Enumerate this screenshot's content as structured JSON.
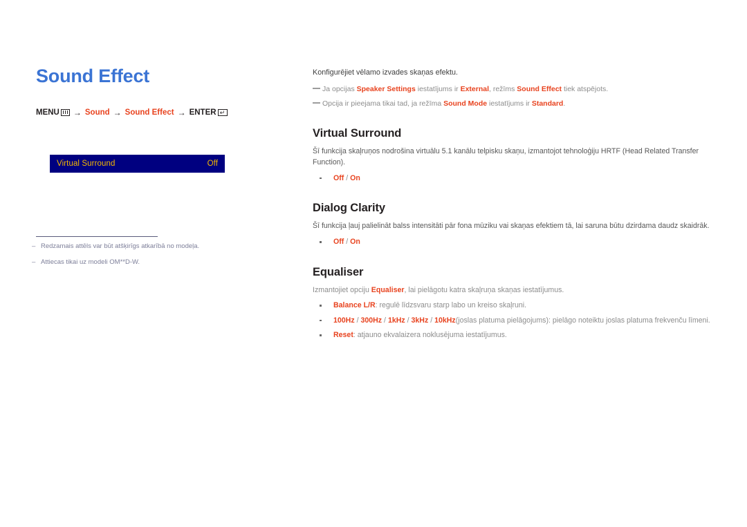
{
  "left": {
    "title": "Sound Effect",
    "menu_path": {
      "menu_label": "MENU",
      "menu_icon": "menu-bars-icon",
      "arrow": "→",
      "step1": "Sound",
      "step2": "Sound Effect",
      "enter_label": "ENTER",
      "enter_icon": "enter-return-icon",
      "enter_glyph": "↵"
    },
    "osd": {
      "label": "Virtual Surround",
      "value": "Off",
      "bg_color": "#000080",
      "text_color": "#f5b800"
    },
    "footnotes": [
      {
        "dash": "–",
        "text": "Redzamais attēls var būt atšķirīgs atkarībā no modeļa."
      },
      {
        "dash": "–",
        "text": "Attiecas tikai uz modeli OM**D-W."
      }
    ]
  },
  "right": {
    "intro": "Konfigurējiet vēlamo izvades skaņas efektu.",
    "notes": [
      {
        "parts": [
          {
            "t": "Ja opcijas ",
            "em": false
          },
          {
            "t": "Speaker Settings",
            "em": true
          },
          {
            "t": " iestatījums ir ",
            "em": false
          },
          {
            "t": "External",
            "em": true
          },
          {
            "t": ", režīms ",
            "em": false
          },
          {
            "t": "Sound Effect",
            "em": true
          },
          {
            "t": " tiek atspējots.",
            "em": false
          }
        ]
      },
      {
        "parts": [
          {
            "t": "Opcija ir pieejama tikai tad, ja režīma ",
            "em": false
          },
          {
            "t": "Sound Mode",
            "em": true
          },
          {
            "t": " iestatījums ir ",
            "em": false
          },
          {
            "t": "Standard",
            "em": true
          },
          {
            "t": ".",
            "em": false
          }
        ]
      }
    ],
    "sections": [
      {
        "heading": "Virtual Surround",
        "desc": "Šī funkcija skaļruņos nodrošina virtuālu 5.1 kanālu telpisku skaņu, izmantojot tehnoloģiju HRTF (Head Related Transfer Function).",
        "bullets": [
          {
            "parts": [
              {
                "t": "Off",
                "em": true
              },
              {
                "t": " / ",
                "em": false
              },
              {
                "t": "On",
                "em": true
              }
            ]
          }
        ]
      },
      {
        "heading": "Dialog Clarity",
        "desc": "Šī funkcija ļauj palielināt balss intensitāti pār fona mūziku vai skaņas efektiem tā, lai saruna būtu dzirdama daudz skaidrāk.",
        "bullets": [
          {
            "parts": [
              {
                "t": "Off",
                "em": true
              },
              {
                "t": " / ",
                "em": false
              },
              {
                "t": "On",
                "em": true
              }
            ]
          }
        ]
      },
      {
        "heading": "Equaliser",
        "desc_parts": [
          {
            "t": "Izmantojiet opciju ",
            "em": false
          },
          {
            "t": "Equaliser",
            "em": true
          },
          {
            "t": ", lai pielāgotu katra skaļruņa skaņas iestatījumus.",
            "em": false
          }
        ],
        "bullets": [
          {
            "parts": [
              {
                "t": "Balance L/R",
                "em": true
              },
              {
                "t": ": regulē līdzsvaru starp labo un kreiso skaļruni.",
                "em": false
              }
            ]
          },
          {
            "parts": [
              {
                "t": "100Hz",
                "em": true
              },
              {
                "t": " / ",
                "em": false
              },
              {
                "t": "300Hz",
                "em": true
              },
              {
                "t": " / ",
                "em": false
              },
              {
                "t": "1kHz",
                "em": true
              },
              {
                "t": " / ",
                "em": false
              },
              {
                "t": "3kHz",
                "em": true
              },
              {
                "t": " / ",
                "em": false
              },
              {
                "t": "10kHz",
                "em": true
              },
              {
                "t": "(joslas platuma pielāgojums): pielāgo noteiktu joslas platuma frekvenču līmeni.",
                "em": false
              }
            ]
          },
          {
            "parts": [
              {
                "t": "Reset",
                "em": true
              },
              {
                "t": ": atjauno ekvalaizera noklusējuma iestatījumus.",
                "em": false
              }
            ]
          }
        ]
      }
    ]
  },
  "colors": {
    "title_blue": "#3b74d4",
    "accent_red": "#e8431f",
    "osd_blue": "#000080",
    "osd_gold": "#f5b800"
  }
}
